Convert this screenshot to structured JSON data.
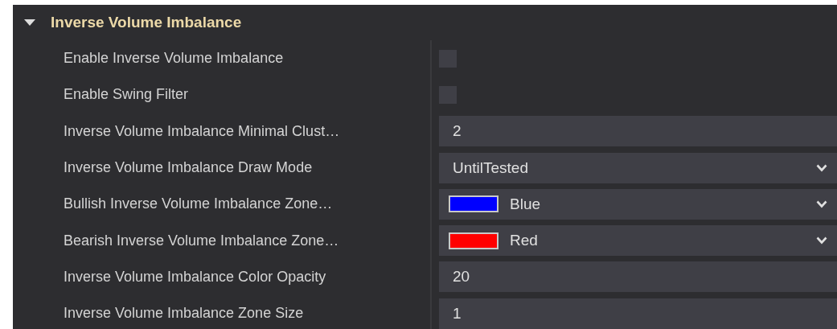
{
  "section": {
    "title": "Inverse Volume Imbalance",
    "expanded": true
  },
  "properties": [
    {
      "label": "Enable Inverse Volume Imbalance",
      "kind": "checkbox",
      "checked": false
    },
    {
      "label": "Enable Swing Filter",
      "kind": "checkbox",
      "checked": false
    },
    {
      "label": "Inverse Volume Imbalance Minimal Clust…",
      "kind": "text",
      "value": "2"
    },
    {
      "label": "Inverse Volume Imbalance Draw Mode",
      "kind": "select",
      "value": "UntilTested"
    },
    {
      "label": "Bullish Inverse Volume Imbalance Zone…",
      "kind": "color",
      "value": "Blue",
      "color": "#0000ff"
    },
    {
      "label": "Bearish Inverse Volume Imbalance Zone…",
      "kind": "color",
      "value": "Red",
      "color": "#ff0000"
    },
    {
      "label": "Inverse Volume Imbalance Color Opacity",
      "kind": "text",
      "value": "20"
    },
    {
      "label": "Inverse Volume Imbalance Zone Size",
      "kind": "text",
      "value": "1"
    }
  ]
}
